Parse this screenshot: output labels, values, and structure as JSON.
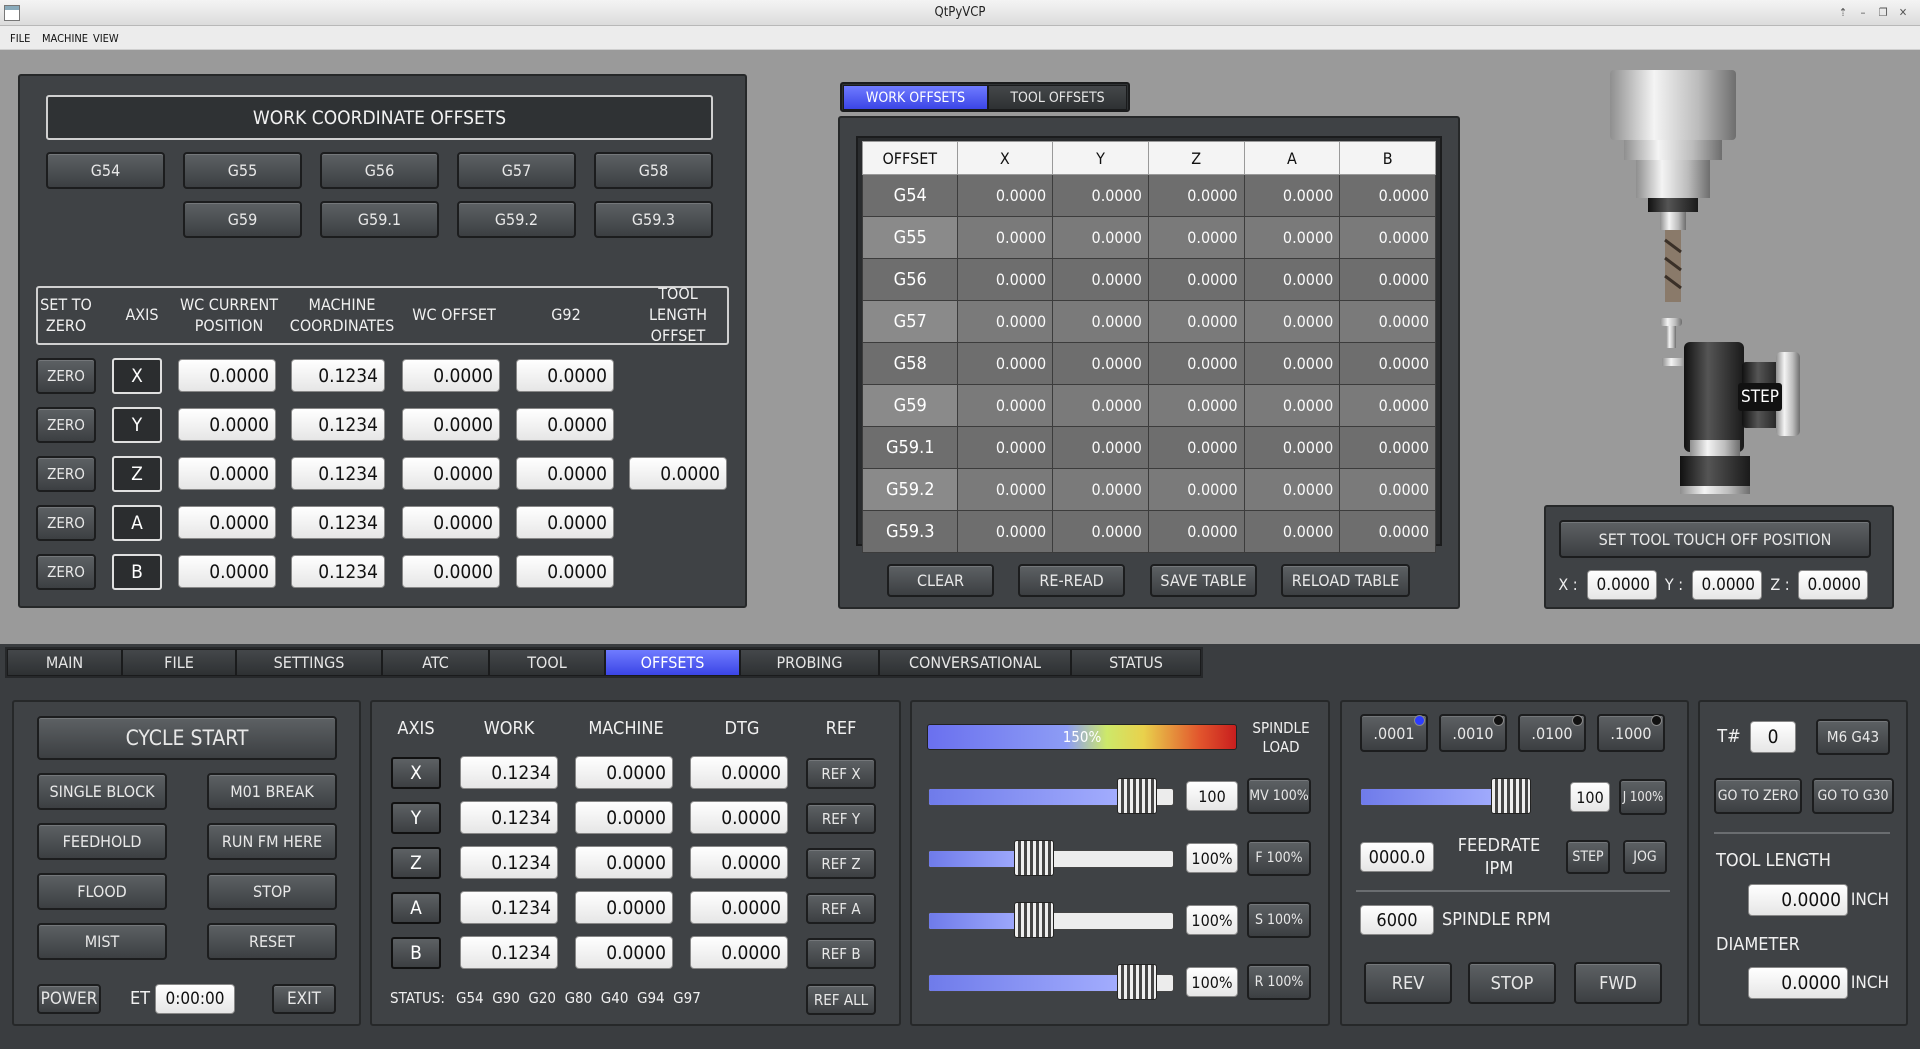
{
  "window": {
    "title": "QtPyVCP"
  },
  "menu": [
    "FILE",
    "MACHINE",
    "VIEW"
  ],
  "wco": {
    "title": "WORK COORDINATE OFFSETS",
    "buttons_row1": [
      "G54",
      "G55",
      "G56",
      "G57",
      "G58"
    ],
    "buttons_row2": [
      "G59",
      "G59.1",
      "G59.2",
      "G59.3"
    ],
    "headers": [
      "SET TO ZERO",
      "AXIS",
      "WC CURRENT POSITION",
      "MACHINE COORDINATES",
      "WC OFFSET",
      "G92",
      "TOOL LENGTH OFFSET"
    ],
    "zero_label": "ZERO",
    "rows": [
      {
        "axis": "X",
        "wc": "0.0000",
        "mach": "0.1234",
        "off": "0.0000",
        "g92": "0.0000"
      },
      {
        "axis": "Y",
        "wc": "0.0000",
        "mach": "0.1234",
        "off": "0.0000",
        "g92": "0.0000"
      },
      {
        "axis": "Z",
        "wc": "0.0000",
        "mach": "0.1234",
        "off": "0.0000",
        "g92": "0.0000"
      },
      {
        "axis": "A",
        "wc": "0.0000",
        "mach": "0.1234",
        "off": "0.0000",
        "g92": "0.0000"
      },
      {
        "axis": "B",
        "wc": "0.0000",
        "mach": "0.1234",
        "off": "0.0000",
        "g92": "0.0000"
      }
    ],
    "tool_length_offset": "0.0000"
  },
  "offsets_panel": {
    "tabs": [
      "WORK OFFSETS",
      "TOOL OFFSETS"
    ],
    "columns": [
      "OFFSET",
      "X",
      "Y",
      "Z",
      "A",
      "B"
    ],
    "rows": [
      [
        "G54",
        "0.0000",
        "0.0000",
        "0.0000",
        "0.0000",
        "0.0000"
      ],
      [
        "G55",
        "0.0000",
        "0.0000",
        "0.0000",
        "0.0000",
        "0.0000"
      ],
      [
        "G56",
        "0.0000",
        "0.0000",
        "0.0000",
        "0.0000",
        "0.0000"
      ],
      [
        "G57",
        "0.0000",
        "0.0000",
        "0.0000",
        "0.0000",
        "0.0000"
      ],
      [
        "G58",
        "0.0000",
        "0.0000",
        "0.0000",
        "0.0000",
        "0.0000"
      ],
      [
        "G59",
        "0.0000",
        "0.0000",
        "0.0000",
        "0.0000",
        "0.0000"
      ],
      [
        "G59.1",
        "0.0000",
        "0.0000",
        "0.0000",
        "0.0000",
        "0.0000"
      ],
      [
        "G59.2",
        "0.0000",
        "0.0000",
        "0.0000",
        "0.0000",
        "0.0000"
      ],
      [
        "G59.3",
        "0.0000",
        "0.0000",
        "0.0000",
        "0.0000",
        "0.0000"
      ]
    ],
    "buttons": [
      "CLEAR",
      "RE-READ",
      "SAVE TABLE",
      "RELOAD TABLE"
    ]
  },
  "touchoff": {
    "step_label": "STEP",
    "button": "SET TOOL TOUCH OFF POSITION",
    "x_label": "X :",
    "x": "0.0000",
    "y_label": "Y :",
    "y": "0.0000",
    "z_label": "Z :",
    "z": "0.0000"
  },
  "tabs": [
    "MAIN",
    "FILE",
    "SETTINGS",
    "ATC",
    "TOOL",
    "OFFSETS",
    "PROBING",
    "CONVERSATIONAL",
    "STATUS"
  ],
  "active_tab": "OFFSETS",
  "cycle": {
    "cycle_start": "CYCLE START",
    "single_block": "SINGLE BLOCK",
    "m01_break": "M01 BREAK",
    "feedhold": "FEEDHOLD",
    "run_fm_here": "RUN FM HERE",
    "flood": "FLOOD",
    "stop": "STOP",
    "mist": "MIST",
    "reset": "RESET",
    "power": "POWER",
    "et_label": "ET",
    "et_value": "0:00:00",
    "exit": "EXIT"
  },
  "dro": {
    "headers": [
      "AXIS",
      "WORK",
      "MACHINE",
      "DTG",
      "REF"
    ],
    "rows": [
      {
        "axis": "X",
        "work": "0.1234",
        "mach": "0.0000",
        "dtg": "0.0000",
        "ref": "REF X"
      },
      {
        "axis": "Y",
        "work": "0.1234",
        "mach": "0.0000",
        "dtg": "0.0000",
        "ref": "REF Y"
      },
      {
        "axis": "Z",
        "work": "0.1234",
        "mach": "0.0000",
        "dtg": "0.0000",
        "ref": "REF Z"
      },
      {
        "axis": "A",
        "work": "0.1234",
        "mach": "0.0000",
        "dtg": "0.0000",
        "ref": "REF A"
      },
      {
        "axis": "B",
        "work": "0.1234",
        "mach": "0.0000",
        "dtg": "0.0000",
        "ref": "REF B"
      }
    ],
    "status_label": "STATUS:",
    "status_codes": "G54  G90  G20  G80  G40  G94  G97",
    "ref_all": "REF ALL"
  },
  "overrides": {
    "spindle_load_label": "SPINDLE LOAD",
    "spindle_load_value": "150%",
    "sliders": [
      {
        "value": "100",
        "fill": 0.85,
        "button": "MV 100%"
      },
      {
        "value": "100%",
        "fill": 0.43,
        "button": "F 100%"
      },
      {
        "value": "100%",
        "fill": 0.43,
        "button": "S 100%"
      },
      {
        "value": "100%",
        "fill": 0.85,
        "button": "R 100%"
      }
    ]
  },
  "jog": {
    "increments": [
      ".0001",
      ".0010",
      ".0100",
      ".1000"
    ],
    "jog_value": "100",
    "jog_button": "J 100%",
    "jog_fill": 0.88,
    "feedrate_value": "0000.0",
    "feedrate_label": "FEEDRATE IPM",
    "step": "STEP",
    "jog": "JOG",
    "rpm_value": "6000",
    "rpm_label": "SPINDLE RPM",
    "rev": "REV",
    "stop": "STOP",
    "fwd": "FWD"
  },
  "tool": {
    "tnum_label": "T#",
    "tnum_value": "0",
    "m6g43": "M6 G43",
    "go_zero": "GO TO ZERO",
    "go_g30": "GO TO G30",
    "length_label": "TOOL LENGTH",
    "length_value": "0.0000",
    "length_unit": "INCH",
    "diameter_label": "DIAMETER",
    "diameter_value": "0.0000",
    "diameter_unit": "INCH"
  },
  "colors": {
    "accent": "#4450f0",
    "panel": "#3f4245",
    "background": "#9a9a9a"
  }
}
